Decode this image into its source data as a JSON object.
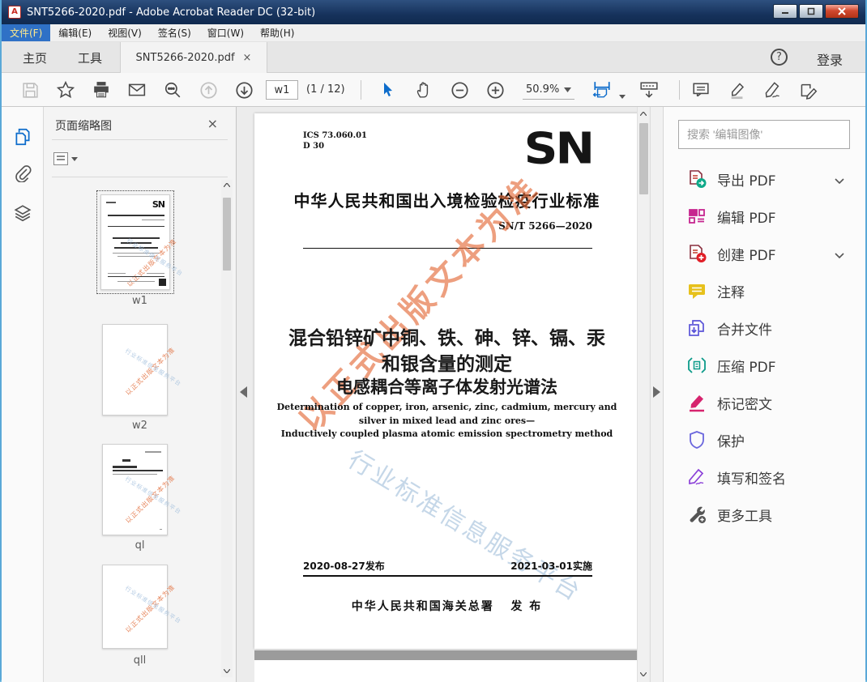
{
  "window": {
    "title": "SNT5266-2020.pdf - Adobe Acrobat Reader DC (32-bit)",
    "controls": {
      "minimize": "—",
      "maximize": "▢",
      "close": "✕"
    }
  },
  "menu_bar": {
    "items": [
      {
        "label": "文件(F)"
      },
      {
        "label": "编辑(E)"
      },
      {
        "label": "视图(V)"
      },
      {
        "label": "签名(S)"
      },
      {
        "label": "窗口(W)"
      },
      {
        "label": "帮助(H)"
      }
    ]
  },
  "tab_bar": {
    "home": "主页",
    "tools": "工具",
    "doc_tab": "SNT5266-2020.pdf",
    "doc_tab_close": "×",
    "help": "?",
    "login": "登录"
  },
  "toolbar": {
    "page_input_value": "w1",
    "page_count": "(1 / 12)",
    "zoom_value": "50.9%"
  },
  "thumbnails_panel": {
    "title": "页面缩略图",
    "close": "×",
    "items": [
      {
        "label": "w1",
        "selected": true
      },
      {
        "label": "w2",
        "selected": false
      },
      {
        "label": "ql",
        "selected": false
      },
      {
        "label": "qll",
        "selected": false
      }
    ]
  },
  "document": {
    "ics_line1": "ICS 73.060.01",
    "ics_line2": "D 30",
    "logo": "SN",
    "standard_heading": "中华人民共和国出入境检验检疫行业标准",
    "standard_number": "SN/T 5266—2020",
    "title_line1": "混合铅锌矿中铜、铁、砷、锌、镉、汞",
    "title_line2": "和银含量的测定",
    "title_line3": "电感耦合等离子体发射光谱法",
    "english_line1": "Determination of copper, iron, arsenic, zinc, cadmium, mercury and",
    "english_line2": "silver in mixed lead and zinc ores—",
    "english_line3": "Inductively coupled plasma atomic emission spectrometry method",
    "issue_date": "2020-08-27发布",
    "implement_date": "2021-03-01实施",
    "publisher": "中华人民共和国海关总署",
    "publish_word": "发 布",
    "watermark_orange": "以正式出版文本为准",
    "watermark_blue": "行业标准信息服务平台"
  },
  "right_panel": {
    "search_placeholder": "搜索 '编辑图像'",
    "tools": [
      {
        "label": "导出 PDF",
        "icon": "export-pdf-icon",
        "chevron": true
      },
      {
        "label": "编辑 PDF",
        "icon": "edit-pdf-icon",
        "chevron": false
      },
      {
        "label": "创建 PDF",
        "icon": "create-pdf-icon",
        "chevron": true
      },
      {
        "label": "注释",
        "icon": "comment-icon",
        "chevron": false
      },
      {
        "label": "合并文件",
        "icon": "combine-files-icon",
        "chevron": false
      },
      {
        "label": "压缩 PDF",
        "icon": "compress-pdf-icon",
        "chevron": false
      },
      {
        "label": "标记密文",
        "icon": "redact-icon",
        "chevron": false
      },
      {
        "label": "保护",
        "icon": "protect-icon",
        "chevron": false
      },
      {
        "label": "填写和签名",
        "icon": "fill-sign-icon",
        "chevron": false
      },
      {
        "label": "更多工具",
        "icon": "more-tools-icon",
        "chevron": false
      }
    ]
  },
  "colors": {
    "acrobat_blue": "#0d6ccb",
    "titlebar_navy": "#16325c",
    "menu_highlight": "#2f71c6",
    "export_teal": "#0fa989",
    "edit_magenta": "#c6268f",
    "create_red": "#e11f27",
    "comment_yellow": "#e7c11c",
    "combine_purple": "#5a54d8",
    "compress_teal": "#0d9b8a",
    "redact_crimson": "#d6246e",
    "protect_indigo": "#6a66dd",
    "fillsign_purple": "#8b40d8",
    "watermark_orange": "#e46c3a",
    "watermark_blue": "#9ebcd8"
  }
}
